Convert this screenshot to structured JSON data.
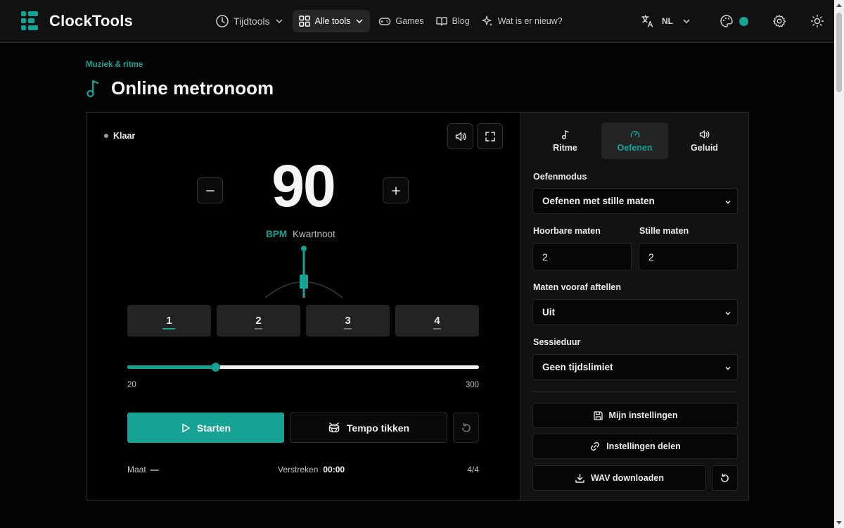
{
  "app": {
    "name": "ClockTools"
  },
  "nav": {
    "time_tools": "Tijdtools",
    "all_tools": "Alle tools",
    "games": "Games",
    "blog": "Blog",
    "whats_new": "Wat is er nieuw?",
    "language": "NL"
  },
  "page": {
    "category": "Muziek & ritme",
    "title": "Online metronoom"
  },
  "metronome": {
    "status": "Klaar",
    "bpm": "90",
    "bpm_unit": "BPM",
    "note_value": "Kwartnoot",
    "beats": [
      "1",
      "2",
      "3",
      "4"
    ],
    "current_beat": 1,
    "tempo_min": "20",
    "tempo_max": "300",
    "tempo_value": 90,
    "start_label": "Starten",
    "tap_label": "Tempo tikken",
    "measure_label": "Maat",
    "measure_value": "—",
    "elapsed_label": "Verstreken",
    "elapsed_value": "00:00",
    "time_signature": "4/4"
  },
  "settings": {
    "tabs": [
      {
        "label": "Ritme",
        "icon": "music-note-icon"
      },
      {
        "label": "Oefenen",
        "icon": "gauge-icon",
        "active": true
      },
      {
        "label": "Geluid",
        "icon": "volume-icon"
      }
    ],
    "practice_mode_label": "Oefenmodus",
    "practice_mode_value": "Oefenen met stille maten",
    "audible_bars_label": "Hoorbare maten",
    "audible_bars_value": "2",
    "silent_bars_label": "Stille maten",
    "silent_bars_value": "2",
    "count_in_label": "Maten vooraf aftellen",
    "count_in_value": "Uit",
    "session_label": "Sessieduur",
    "session_value": "Geen tijdslimiet",
    "my_settings": "Mijn instellingen",
    "share_settings": "Instellingen delen",
    "download_wav": "WAV downloaden"
  },
  "colors": {
    "accent": "#16a394",
    "background": "#050505",
    "panel": "#121212"
  }
}
